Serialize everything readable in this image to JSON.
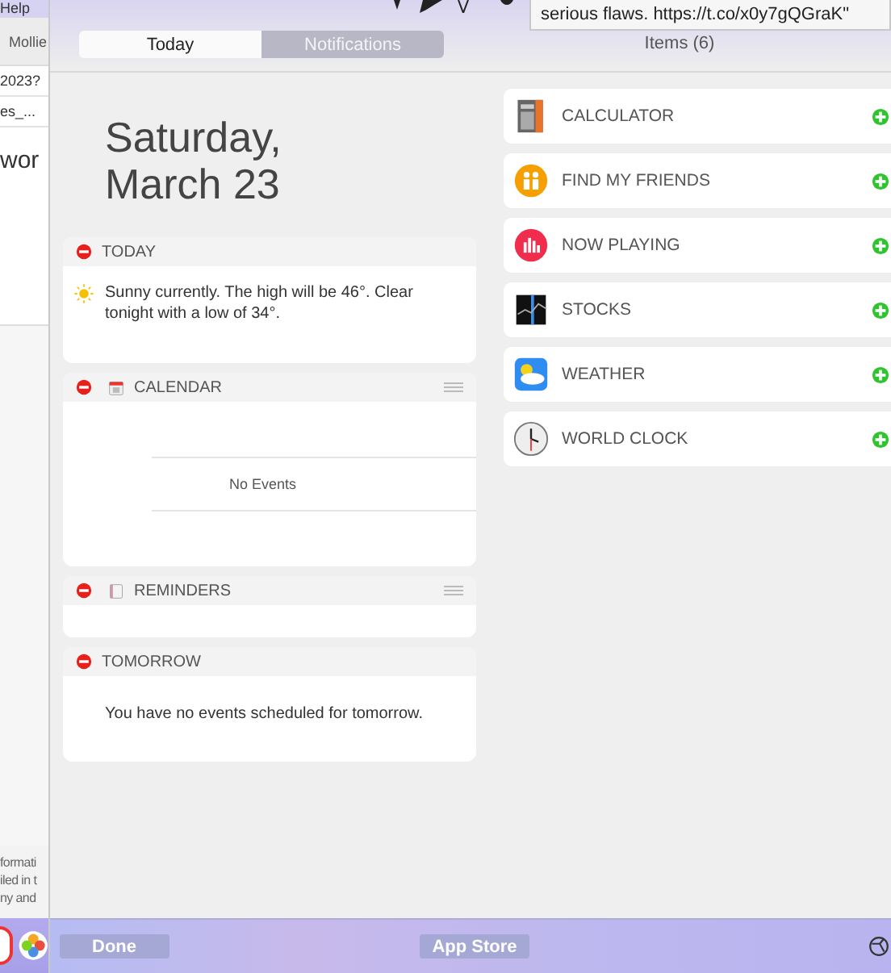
{
  "background_window": {
    "menu": "Help",
    "toolbar_text": "Mollie",
    "lines": [
      "2023?",
      "es_..."
    ],
    "heading": "wor",
    "footer_lines": [
      "formati",
      "iled in t",
      "ny and"
    ]
  },
  "tooltip": {
    "text": "serious flaws. https://t.co/x0y7gQGraK\""
  },
  "tabs": [
    {
      "label": "Today",
      "selected": true
    },
    {
      "label": "Notifications",
      "selected": false
    }
  ],
  "items_count": "Items (6)",
  "date": {
    "line1": "Saturday,",
    "line2": "March 23"
  },
  "widgets": [
    {
      "kind": "weather",
      "title": "TODAY",
      "movable": false,
      "text": "Sunny currently. The high will be 46°. Clear tonight with a low of 34°."
    },
    {
      "kind": "calendar",
      "title": "CALENDAR",
      "movable": true,
      "text": "No Events"
    },
    {
      "kind": "reminders",
      "title": "REMINDERS",
      "movable": true
    },
    {
      "kind": "events",
      "title": "TOMORROW",
      "movable": false,
      "text": "You have no events scheduled for tomorrow."
    }
  ],
  "available": [
    {
      "kind": "calculator",
      "label": "CALCULATOR"
    },
    {
      "kind": "friends",
      "label": "FIND MY FRIENDS"
    },
    {
      "kind": "music",
      "label": "NOW PLAYING"
    },
    {
      "kind": "stocks",
      "label": "STOCKS"
    },
    {
      "kind": "weather",
      "label": "WEATHER"
    },
    {
      "kind": "clock",
      "label": "WORLD CLOCK"
    }
  ],
  "footer": {
    "done": "Done",
    "store": "App Store"
  }
}
